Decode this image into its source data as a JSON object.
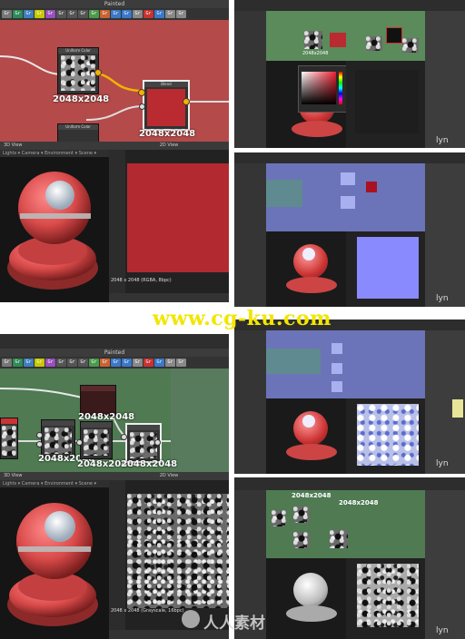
{
  "watermark_url": "www.cg-ku.com",
  "watermark_cn": "人人素材",
  "lynda": "lyn",
  "panels": {
    "tl": {
      "title": "Painted",
      "res_a": "2048x2048",
      "res_b": "2048x2048",
      "view3d": "3D View",
      "view2d": "2D View",
      "node_a": "Uniform Color",
      "node_b": "Blend",
      "node_c": "Uniform Color",
      "menus": "Lights  ▾  Camera  ▾  Environment  ▾  Scene  ▾",
      "status": "2048 x 2048 (RGBA, 8bpc)"
    },
    "bl": {
      "title": "Painted",
      "res_a": "2048x2048",
      "res_b": "2048x2048",
      "res_c": "2048x2048",
      "res_d": "2048x2048",
      "view3d": "3D View",
      "view2d": "2D View",
      "menus": "Lights  ▾  Camera  ▾  Environment  ▾  Scene  ▾",
      "status": "2048 x 2048 (Grayscale, 16bpc)"
    },
    "r1": {
      "res_a": "2048x2048"
    },
    "r4": {
      "res_a": "2048x2048",
      "res_b": "2048x2048"
    }
  },
  "toolbar_chips": [
    {
      "t": "Gr",
      "c": "#777"
    },
    {
      "t": "Gr",
      "c": "#2e8b57"
    },
    {
      "t": "Gr",
      "c": "#3f7fbf"
    },
    {
      "t": "Gr",
      "c": "#c8c800"
    },
    {
      "t": "Gr",
      "c": "#9a4fbf"
    },
    {
      "t": "Gr",
      "c": "#555"
    },
    {
      "t": "Gr",
      "c": "#555"
    },
    {
      "t": "Gr",
      "c": "#555"
    },
    {
      "t": "Gr",
      "c": "#555"
    },
    {
      "t": "Gr",
      "c": "#4a9a4a"
    },
    {
      "t": "Gr",
      "c": "#c86432"
    },
    {
      "t": "Gr",
      "c": "#3a78c8"
    },
    {
      "t": "Gr",
      "c": "#3a78c8"
    },
    {
      "t": "Gr",
      "c": "#888"
    },
    {
      "t": "Gr",
      "c": "#c83232"
    },
    {
      "t": "Gr",
      "c": "#3a78c8"
    },
    {
      "t": "Gr",
      "c": "#888"
    }
  ],
  "colors": {
    "red_graph": "#b54a4a",
    "green_graph": "#4f7a52",
    "blue_graph": "#6b74b8",
    "red_swatch": "#b92b30"
  }
}
